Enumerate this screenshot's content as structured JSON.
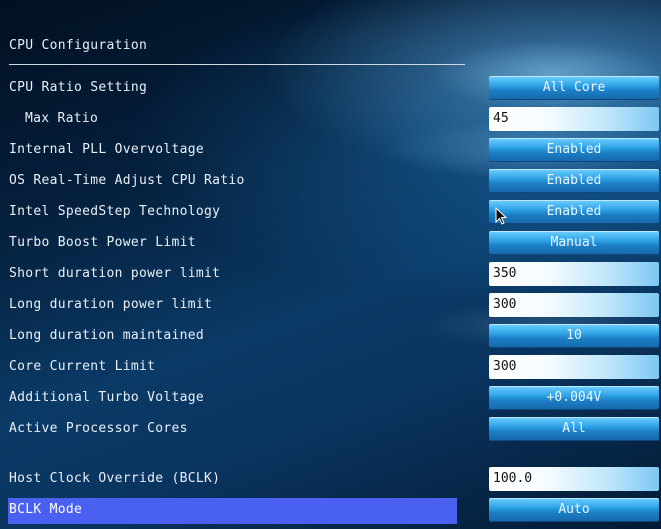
{
  "section_title": "CPU Configuration",
  "settings": [
    {
      "label": "CPU Ratio Setting",
      "value": "All Core",
      "kind": "select"
    },
    {
      "label": "Max Ratio",
      "value": "45",
      "kind": "input"
    },
    {
      "label": "Internal PLL Overvoltage",
      "value": "Enabled",
      "kind": "select"
    },
    {
      "label": "OS Real-Time Adjust CPU Ratio",
      "value": "Enabled",
      "kind": "select"
    },
    {
      "label": "Intel SpeedStep Technology",
      "value": "Enabled",
      "kind": "select"
    },
    {
      "label": "Turbo Boost Power Limit",
      "value": "Manual",
      "kind": "select"
    },
    {
      "label": "Short duration power limit",
      "value": "350",
      "kind": "input"
    },
    {
      "label": "Long duration power limit",
      "value": "300",
      "kind": "input"
    },
    {
      "label": "Long duration maintained",
      "value": "10",
      "kind": "select"
    },
    {
      "label": "Core Current Limit",
      "value": "300",
      "kind": "input"
    },
    {
      "label": "Additional Turbo Voltage",
      "value": "+0.004V",
      "kind": "select"
    },
    {
      "label": "Active Processor Cores",
      "value": "All",
      "kind": "select"
    },
    {
      "label": "Host Clock Override (BCLK)",
      "value": "100.0",
      "kind": "input"
    },
    {
      "label": "BCLK Mode",
      "value": "Auto",
      "kind": "select",
      "selected": true
    }
  ],
  "colors": {
    "highlight": "#4a60f0",
    "select_button": "#2ea2e6",
    "input_field": "#ffffff",
    "background": "#0a3a66"
  },
  "icons": [
    "mouse-pointer-icon"
  ]
}
